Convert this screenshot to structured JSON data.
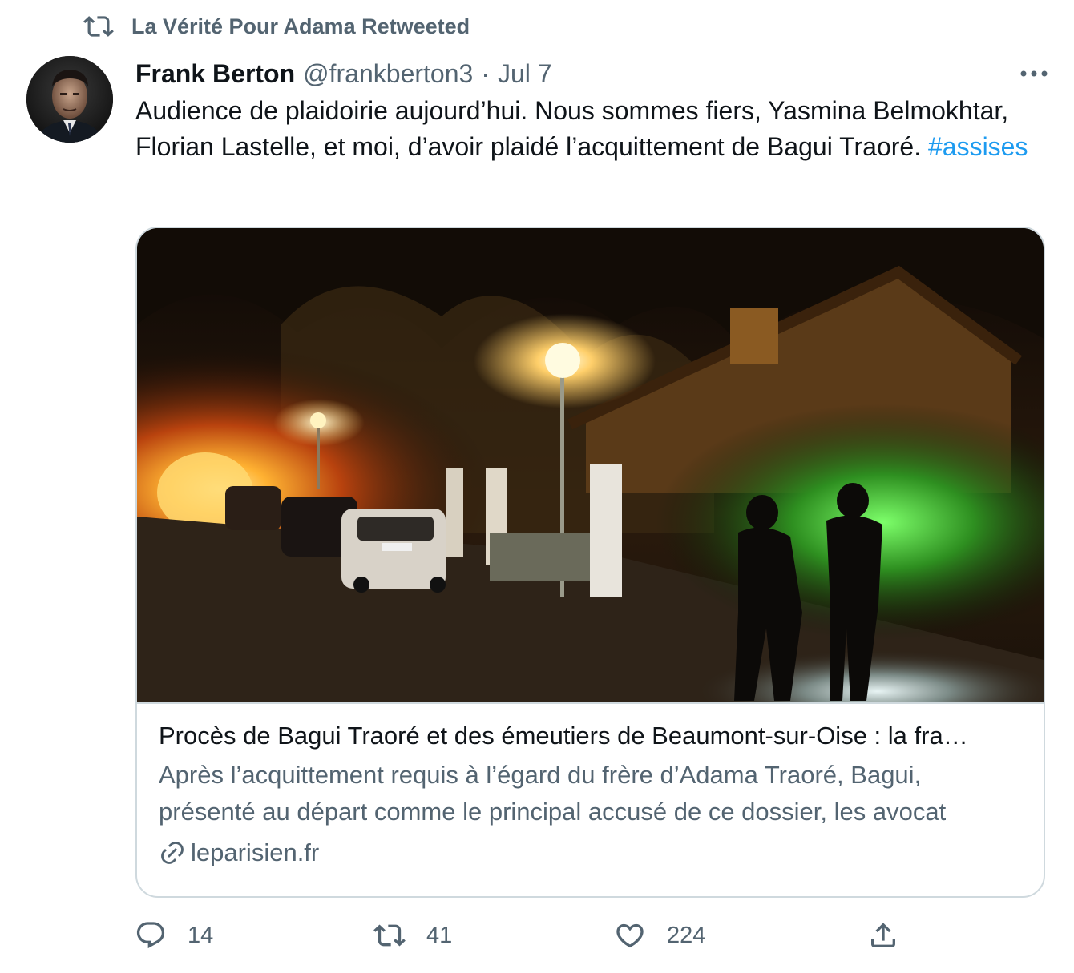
{
  "retweet_context": {
    "label": "La Vérité Pour Adama Retweeted",
    "icon": "retweet-icon"
  },
  "tweet": {
    "author_name": "Frank Berton",
    "author_handle": "@frankberton3",
    "separator": "·",
    "date": "Jul 7",
    "text_main": "Audience de plaidoirie aujourd’hui. Nous sommes fiers, Yasmina Belmokhtar, Florian Lastelle, et moi, d’avoir plaidé l’acquittement de Bagui Traoré.",
    "hashtag": "#assises"
  },
  "card": {
    "title": "Procès de Bagui Traoré et des émeutiers de Beaumont-sur-Oise : la fra…",
    "description": "Après l’acquittement requis à l’égard du frère d’Adama Traoré, Bagui, présenté au départ comme le principal accusé de ce dossier, les avocat",
    "domain": "leparisien.fr",
    "image_icon": "night-street-fire-photo"
  },
  "actions": {
    "reply_count": "14",
    "retweet_count": "41",
    "like_count": "224"
  },
  "colors": {
    "text_primary": "#0f1419",
    "text_secondary": "#536471",
    "link": "#1d9bf0",
    "border": "#cfd9de"
  }
}
